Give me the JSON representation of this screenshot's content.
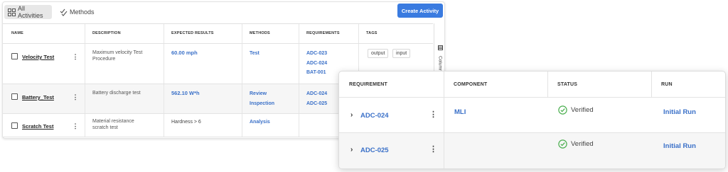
{
  "toolbar": {
    "all_activities_label": "All Activities",
    "methods_label": "Methods",
    "create_activity_label": "Create Activity"
  },
  "colors": {
    "accent": "#3a7be0",
    "link": "#3a70c8",
    "verified": "#4caf50"
  },
  "grid": {
    "columns": [
      "NAME",
      "DESCRIPTION",
      "EXPECTED RESULTS",
      "METHODS",
      "REQUIREMENTS",
      "TAGS"
    ],
    "columns_toggle_label": "Columns",
    "rows": [
      {
        "name": "Velocity Test",
        "description": "Maximum velocity Test Procedure",
        "expected": "60.00  mph",
        "methods": [
          "Test"
        ],
        "requirements": [
          "ADC-023",
          "ADC-024",
          "BAT-001"
        ],
        "tags": [
          "output",
          "input"
        ]
      },
      {
        "name": "Battery_Test",
        "description": "Battery discharge test",
        "expected": "562.10  W*h",
        "methods": [
          "Review",
          "Inspection"
        ],
        "requirements": [
          "ADC-024",
          "ADC-025"
        ],
        "tags": []
      },
      {
        "name": "Scratch Test",
        "description": "Material resistance scratch test",
        "expected": "Hardness > 6",
        "methods": [
          "Analysis"
        ],
        "requirements": [],
        "tags": []
      }
    ]
  },
  "requirement_card": {
    "columns": [
      "REQUIREMENT",
      "COMPONENT",
      "STATUS",
      "RUN"
    ],
    "rows": [
      {
        "requirement": "ADC-024",
        "component": "MLI",
        "status": "Verified",
        "run": "Initial Run"
      },
      {
        "requirement": "ADC-025",
        "component": "",
        "status": "Verified",
        "run": "Initial Run"
      }
    ]
  }
}
